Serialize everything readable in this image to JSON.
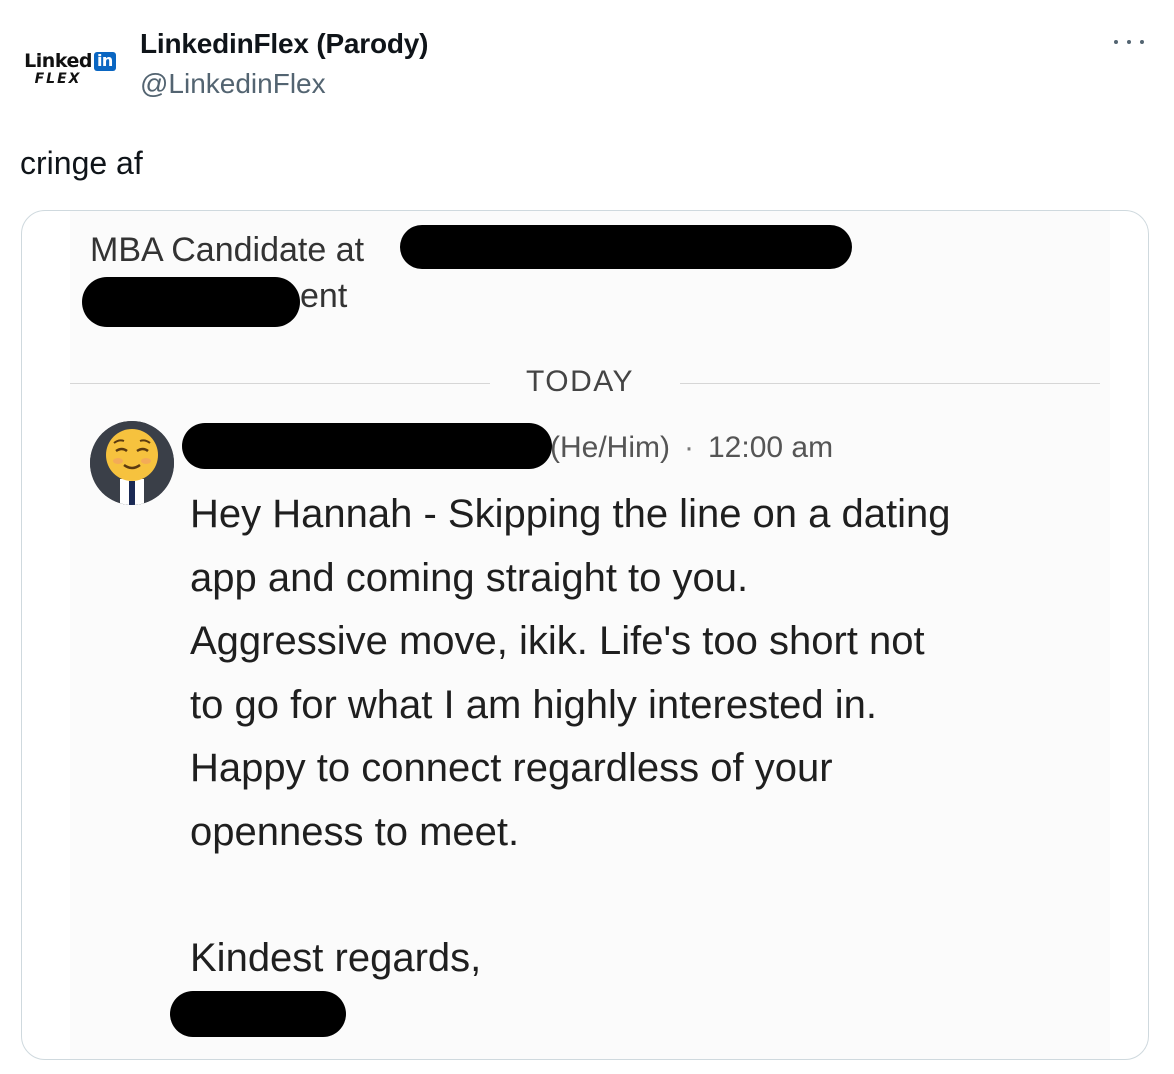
{
  "account": {
    "display_name": "LinkedinFlex (Parody)",
    "handle": "@LinkedinFlex",
    "logo": {
      "word": "Linked",
      "badge": "in",
      "sub": "FLEX",
      "brand_color": "#0a66c2"
    }
  },
  "menu": {
    "icon": "more-horizontal-icon"
  },
  "tweet": {
    "text": "cringe af"
  },
  "screenshot": {
    "headline_prefix": "MBA Candidate at",
    "headline_suffix": "ent",
    "day_divider": "TODAY",
    "sender_pronouns": "(He/Him)",
    "timestamp": "12:00 am",
    "avatar_emoji": "😌",
    "message_lines": [
      "Hey Hannah - Skipping the line on a dating",
      "app and coming straight to you.",
      "Aggressive move, ikik. Life's too short not",
      "to go for what I am highly interested in.",
      "Happy to connect regardless of your",
      "openness to meet."
    ],
    "signoff": "Kindest regards,"
  }
}
